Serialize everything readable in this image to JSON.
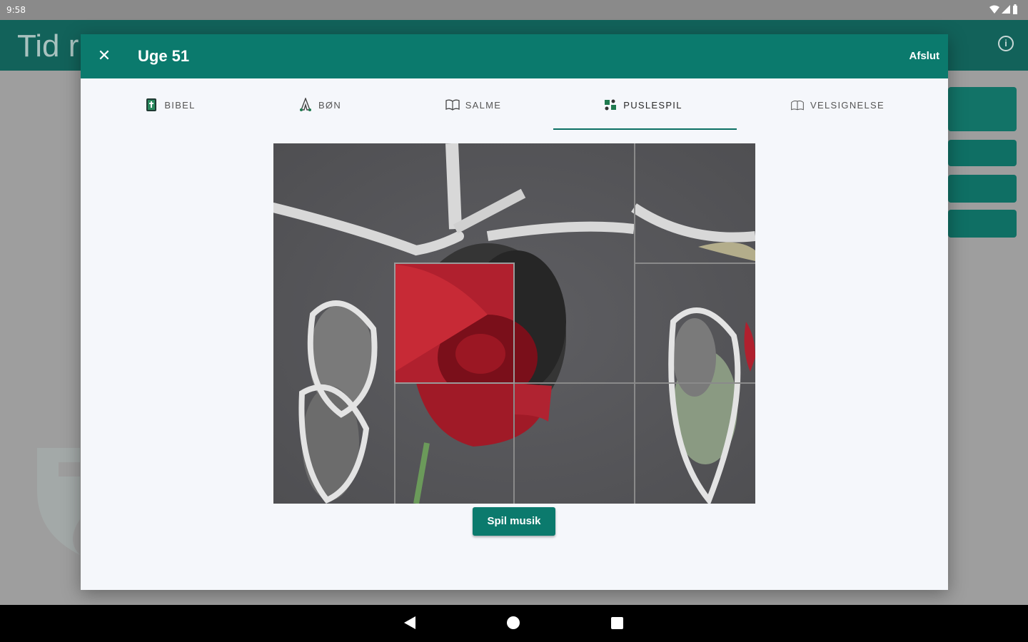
{
  "status_bar": {
    "time": "9:58"
  },
  "app": {
    "title": "Tid r"
  },
  "dialog": {
    "title": "Uge 51",
    "close_icon": "close-icon",
    "exit_label": "Afslut",
    "tabs": [
      {
        "label": "BIBEL",
        "icon": "bible-icon",
        "selected": false
      },
      {
        "label": "BØN",
        "icon": "prayer-icon",
        "selected": false
      },
      {
        "label": "SALME",
        "icon": "hymn-book-icon",
        "selected": false
      },
      {
        "label": "PUSLESPIL",
        "icon": "puzzle-icon",
        "selected": true
      },
      {
        "label": "VELSIGNELSE",
        "icon": "blessing-hands-icon",
        "selected": false
      }
    ],
    "puzzle": {
      "image": "frosted red rose",
      "grid": "4x3"
    },
    "play_music_label": "Spil musik"
  },
  "colors": {
    "primary": "#0b7a6d",
    "app_bar": "#12625a",
    "dialog_bg": "#f5f7fb"
  }
}
